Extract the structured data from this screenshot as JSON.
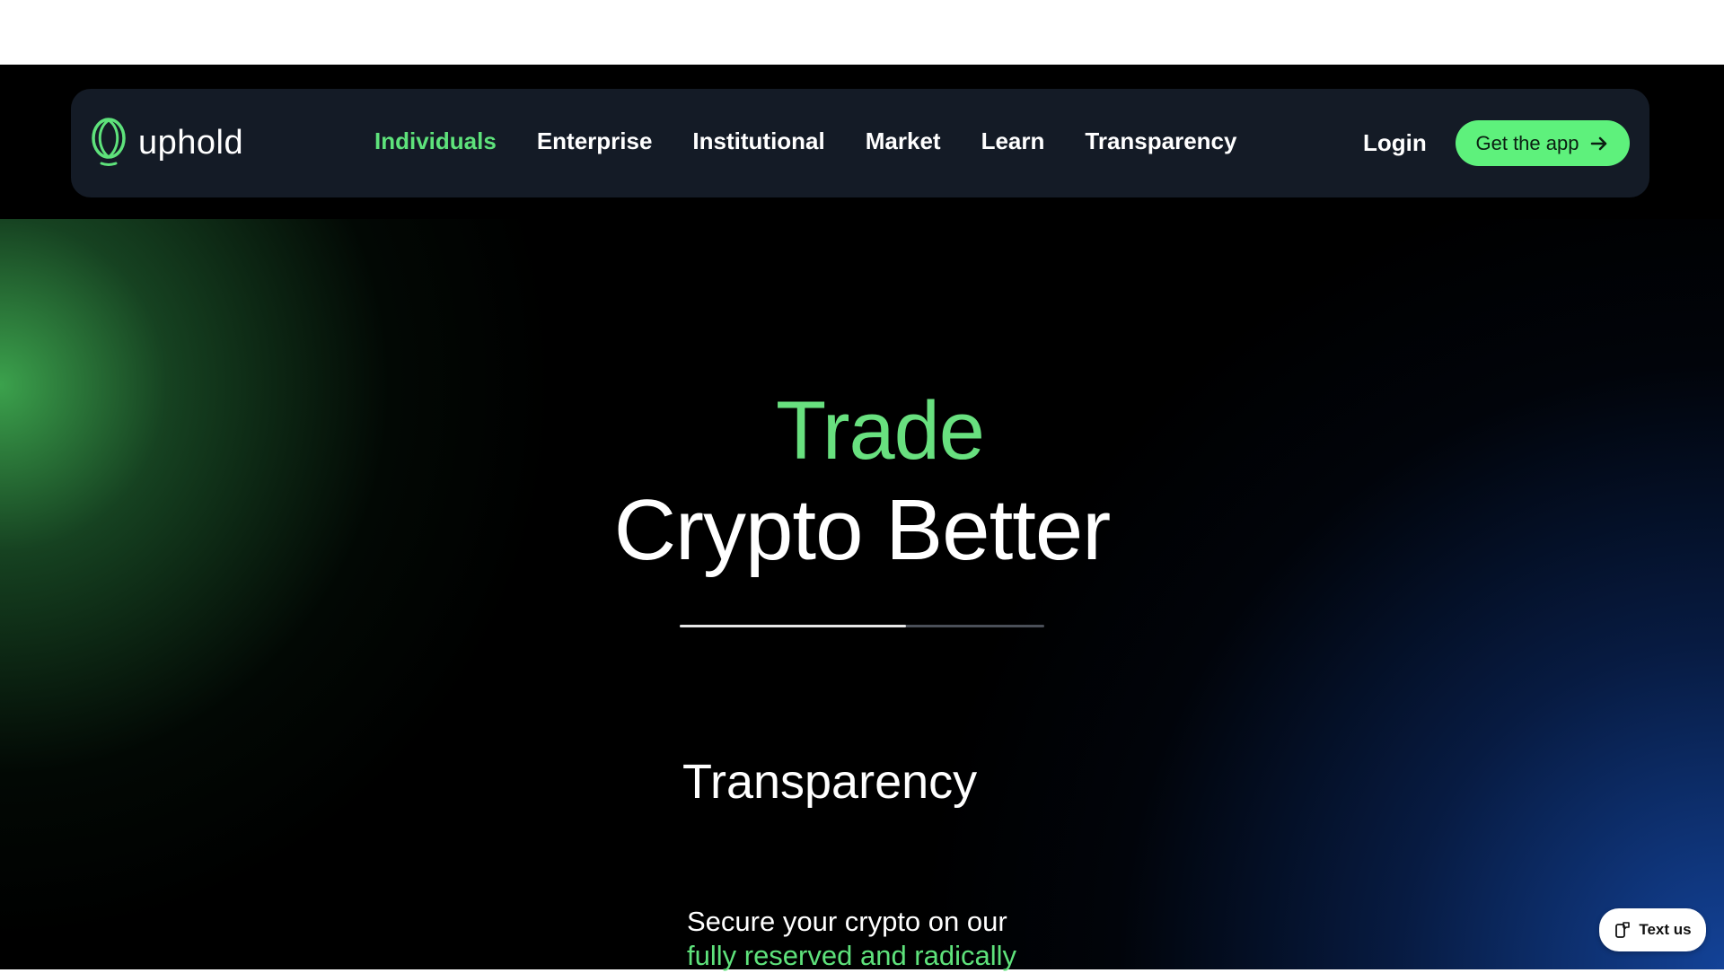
{
  "brand": {
    "name": "uphold",
    "logo_icon": "uphold-logo-icon",
    "accent_color": "#5ee27b"
  },
  "nav": {
    "items": [
      {
        "label": "Individuals",
        "active": true
      },
      {
        "label": "Enterprise",
        "active": false
      },
      {
        "label": "Institutional",
        "active": false
      },
      {
        "label": "Market",
        "active": false
      },
      {
        "label": "Learn",
        "active": false
      },
      {
        "label": "Transparency",
        "active": false
      }
    ],
    "login_label": "Login",
    "cta_label": "Get the app",
    "cta_icon": "arrow-right-icon"
  },
  "hero": {
    "headline_line1": "Trade",
    "headline_line2": "Crypto Better",
    "carousel_progress": 0.62,
    "slide_title": "Transparency",
    "slide_desc_line1": "Secure your crypto on our",
    "slide_desc_line2": "fully reserved and radically"
  },
  "chat": {
    "label": "Text us",
    "icon": "chat-phone-icon"
  }
}
